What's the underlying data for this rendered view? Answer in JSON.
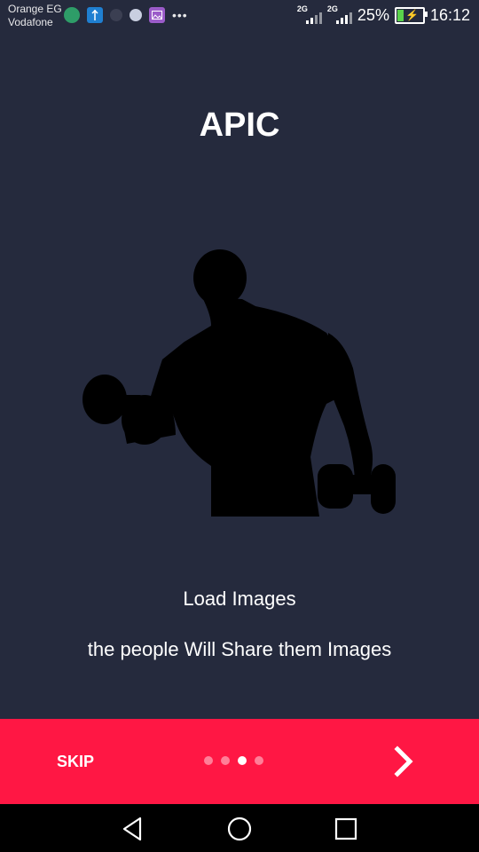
{
  "status_bar": {
    "carrier_1": "Orange EG",
    "carrier_2": "Vodafone",
    "notification_icons": [
      "globe-icon",
      "usb-icon",
      "message-icon",
      "ball-icon",
      "gallery-icon"
    ],
    "more": "•••",
    "signal_1_label": "2G",
    "signal_2_label": "2G",
    "battery_percent": "25%",
    "battery_level": 0.25,
    "charging": true,
    "time": "16:12"
  },
  "app": {
    "title": "APIC",
    "hero_image": "bodybuilder-silhouette",
    "slide_title": "Load Images",
    "slide_subtitle": "the people Will Share them Images"
  },
  "bottom_bar": {
    "skip_label": "SKIP",
    "page_count": 4,
    "active_page": 3,
    "next_icon": "chevron-right-icon",
    "color": "#ff1744"
  },
  "nav_bar": {
    "buttons": [
      "back-icon",
      "home-icon",
      "recents-icon"
    ]
  },
  "colors": {
    "background": "#252a3d",
    "accent": "#ff1744"
  }
}
